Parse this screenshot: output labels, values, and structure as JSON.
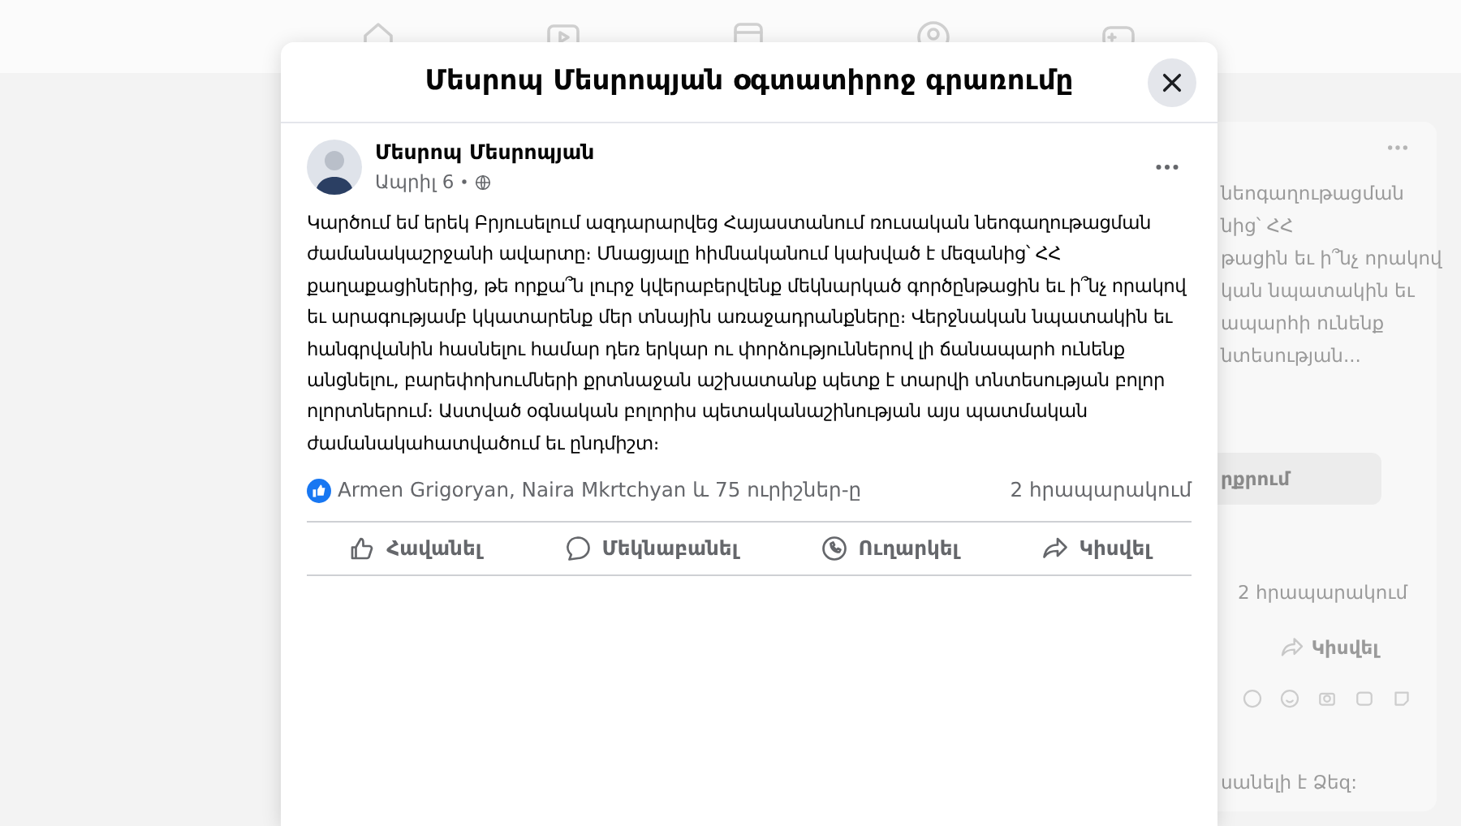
{
  "nav_icons": [
    {
      "kind": "home"
    },
    {
      "kind": "video"
    },
    {
      "kind": "store"
    },
    {
      "kind": "groups"
    },
    {
      "kind": "gaming"
    }
  ],
  "background_post": {
    "text_lines": [
      "նեոգաղութացման",
      "նից՝ ՀՀ",
      "թացին եւ ի՞նչ որակով",
      "կան նպատակին եւ",
      "ապարհի ունենք",
      "նտեսության..."
    ],
    "button": "րքրում",
    "shares": "2 հրապարակում",
    "share_action": "Կիսվել",
    "footer": "սանելի է Ձեզ:"
  },
  "dialog": {
    "title": "Մեսրոպ Մեսրոպյան օգտատիրոջ գրառումը",
    "post": {
      "author": "Մեսրոպ Մեսրոպյան",
      "date": "Ապրիլ 6",
      "text": "Կարծում եմ երեկ Բրյուսելում ազդարարվեց Հայաստանում ռուսական նեոգաղութացման ժամանակաշրջանի ավարտը։ Մնացյալը հիմնականում կախված է մեզանից՝ ՀՀ քաղաքացիներից, թե որքա՞ն լուրջ կվերաբերվենք մեկնարկած գործընթացին եւ ի՞նչ որակով եւ արագությամբ կկատարենք մեր տնային առաջադրանքները։ Վերջնական նպատակին եւ հանգրվանին հասնելու համար դեռ երկար ու փորձություններով լի ճանապարհ ունենք անցնելու, բարեփոխումների քրտնաջան աշխատանք պետք է տարվի տնտեսության բոլոր ոլորտներում։ Աստված օգնական բոլորիս պետականաշինության այս պատմական ժամանակահատվածում եւ ընդմիշտ։",
      "reactions": "Armen Grigoryan, Naira Mkrtchyan և 75 ուրիշներ-ը",
      "shares": "2 հրապարակում",
      "actions": [
        {
          "kind": "like",
          "label": "Հավանել"
        },
        {
          "kind": "comment",
          "label": "Մեկնաբանել"
        },
        {
          "kind": "send",
          "label": "Ուղարկել"
        },
        {
          "kind": "share",
          "label": "Կիսվել"
        }
      ]
    }
  }
}
